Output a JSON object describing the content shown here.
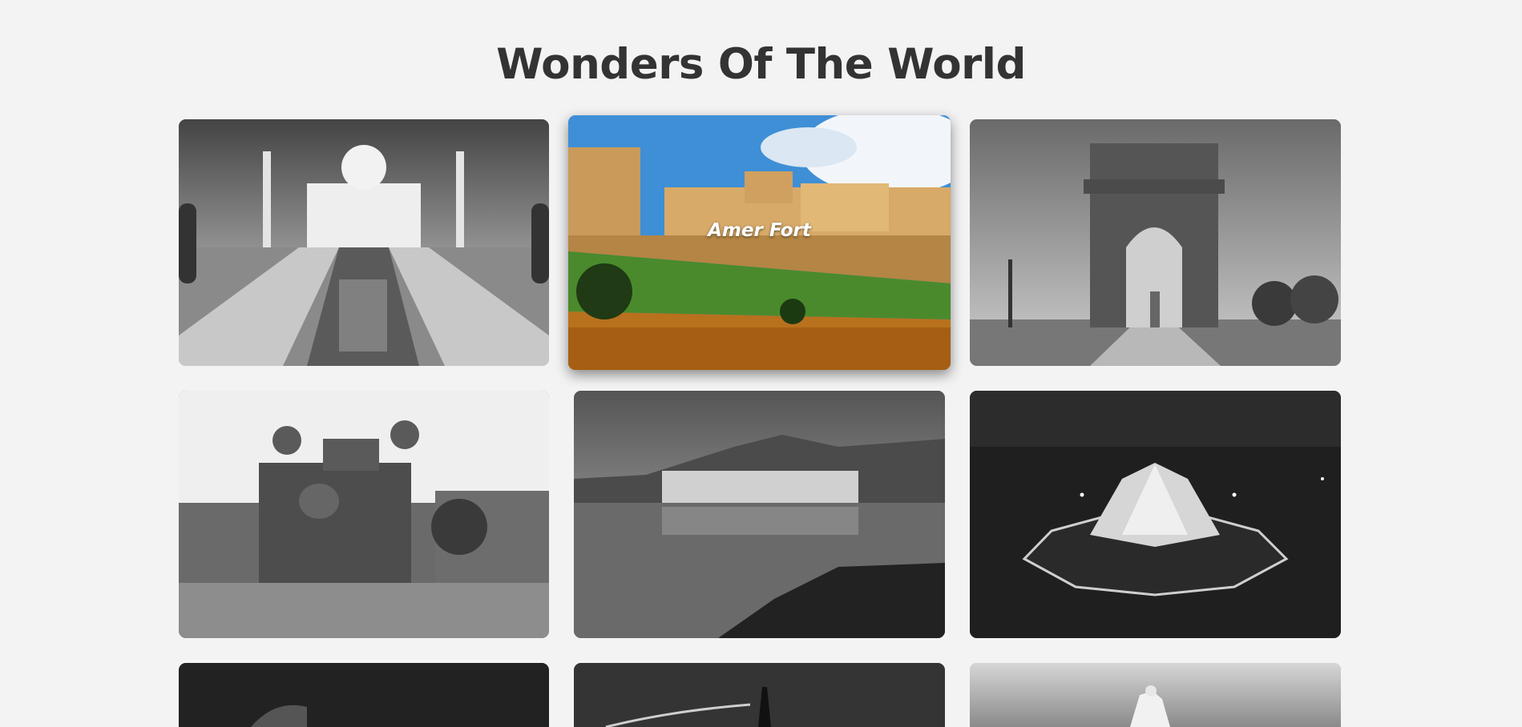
{
  "page": {
    "title": "Wonders Of The World"
  },
  "gallery": {
    "cards": [
      {
        "name": "taj-mahal",
        "caption": "",
        "mode": "grayscale"
      },
      {
        "name": "amer-fort",
        "caption": "Amer Fort",
        "mode": "color",
        "state": "hovered"
      },
      {
        "name": "india-gate",
        "caption": "",
        "mode": "grayscale"
      },
      {
        "name": "red-fort",
        "caption": "",
        "mode": "grayscale"
      },
      {
        "name": "jal-mahal",
        "caption": "",
        "mode": "grayscale"
      },
      {
        "name": "lotus-temple",
        "caption": "",
        "mode": "grayscale"
      },
      {
        "name": "colosseum",
        "caption": "",
        "mode": "grayscale"
      },
      {
        "name": "eiffel-tower",
        "caption": "",
        "mode": "grayscale"
      },
      {
        "name": "christ-the-redeemer",
        "caption": "",
        "mode": "grayscale"
      }
    ]
  },
  "colors": {
    "background": "#f3f3f3",
    "title": "#333333",
    "caption": "#ffffff"
  }
}
